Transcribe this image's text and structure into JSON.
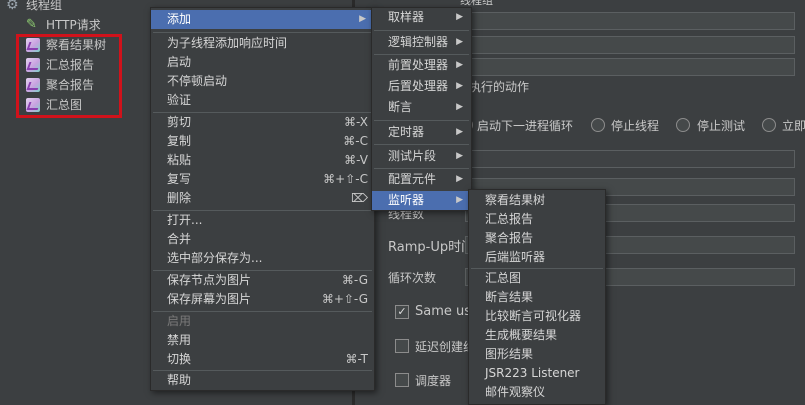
{
  "tree": {
    "thread_group": "线程组",
    "http": "HTTP请求",
    "listeners": [
      "察看结果树",
      "汇总报告",
      "聚合报告",
      "汇总图"
    ]
  },
  "right": {
    "partial_top": "线程组",
    "action_label": "执行的动作",
    "radio_labels": [
      "启动下一进程循环",
      "停止线程",
      "停止测试",
      "立即"
    ],
    "rampup": "Ramp-Up时间",
    "loop": "循环次数",
    "same_user": "Same use",
    "delay": "延迟创建线",
    "scheduler": "调度器",
    "partial_threads": "线程数"
  },
  "menu1": {
    "items": [
      {
        "label": "添加",
        "shortcut": "",
        "submenu": true,
        "selected": true
      },
      {
        "label": "为子线程添加响应时间"
      },
      {
        "label": "启动"
      },
      {
        "label": "不停顿启动"
      },
      {
        "label": "验证"
      },
      {
        "label": "剪切",
        "shortcut": "⌘-X"
      },
      {
        "label": "复制",
        "shortcut": "⌘-C"
      },
      {
        "label": "粘贴",
        "shortcut": "⌘-V"
      },
      {
        "label": "复写",
        "shortcut": "⌘+⇧-C"
      },
      {
        "label": "删除",
        "shortcut": "⌦"
      },
      {
        "label": "打开..."
      },
      {
        "label": "合并"
      },
      {
        "label": "选中部分保存为..."
      },
      {
        "label": "保存节点为图片",
        "shortcut": "⌘-G"
      },
      {
        "label": "保存屏幕为图片",
        "shortcut": "⌘+⇧-G"
      },
      {
        "label": "启用",
        "disabled": true
      },
      {
        "label": "禁用"
      },
      {
        "label": "切换",
        "shortcut": "⌘-T"
      },
      {
        "label": "帮助"
      }
    ]
  },
  "menu2": {
    "items": [
      "取样器",
      "逻辑控制器",
      "前置处理器",
      "后置处理器",
      "断言",
      "定时器",
      "测试片段",
      "配置元件",
      "监听器"
    ]
  },
  "menu3": {
    "items": [
      "察看结果树",
      "汇总报告",
      "聚合报告",
      "后端监听器",
      "汇总图",
      "断言结果",
      "比较断言可视化器",
      "生成概要结果",
      "图形结果",
      "JSR223 Listener",
      "邮件观察仪"
    ]
  },
  "colors": {
    "selection": "#4b6eaf",
    "highlight_box": "#d0121b"
  }
}
